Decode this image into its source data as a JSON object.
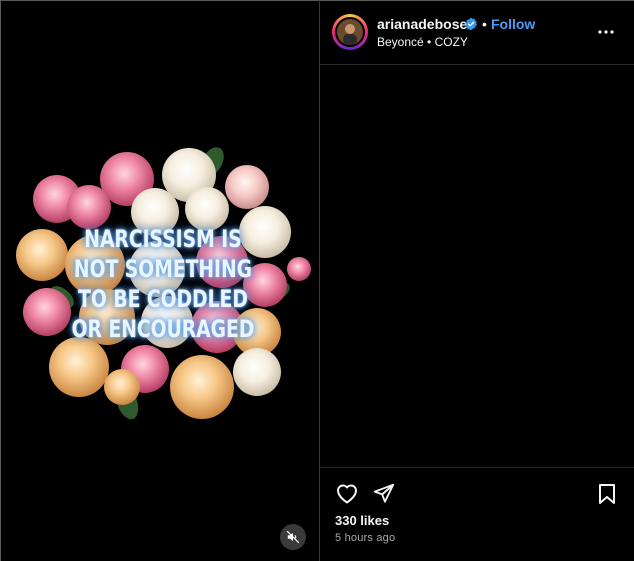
{
  "post": {
    "username": "arianadebose",
    "follow_label": "Follow",
    "separator": "•",
    "song": "Beyoncé • COZY",
    "quote": "NARCISSISM IS NOT SOMETHING TO BE CODDLED OR ENCOURAGED",
    "likes": "330 likes",
    "timestamp": "5 hours ago"
  },
  "icons": {
    "verified": "verified-badge-icon",
    "more": "more-options-icon",
    "like": "heart-icon",
    "share": "share-icon",
    "save": "bookmark-icon",
    "mute": "muted-speaker-icon"
  },
  "colors": {
    "background": "#000000",
    "follow": "#4a9df8",
    "verified": "#3897f0",
    "quote_glow": "#5aa0e8"
  }
}
